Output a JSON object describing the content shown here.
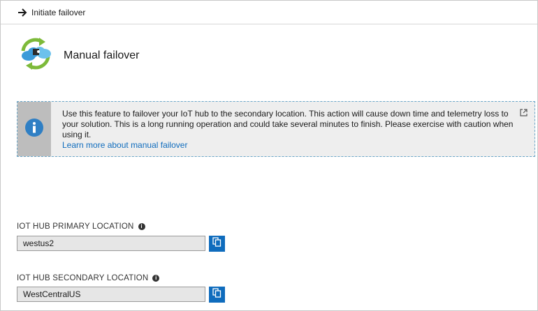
{
  "toolbar": {
    "initiate_label": "Initiate failover"
  },
  "page": {
    "title": "Manual failover"
  },
  "info": {
    "message": "Use this feature to failover your IoT hub to the secondary location. This action will cause down time and telemetry loss to your solution. This is a long running operation and could take several minutes to finish. Please exercise with caution when using it.",
    "link_text": "Learn more about manual failover"
  },
  "primary": {
    "label": "IOT HUB PRIMARY LOCATION",
    "value": "westus2"
  },
  "secondary": {
    "label": "IOT HUB SECONDARY LOCATION",
    "value": "WestCentralUS"
  },
  "colors": {
    "accent": "#0f6cbd",
    "info_side": "#bdbdbd",
    "info_bg": "#eeeeee"
  }
}
